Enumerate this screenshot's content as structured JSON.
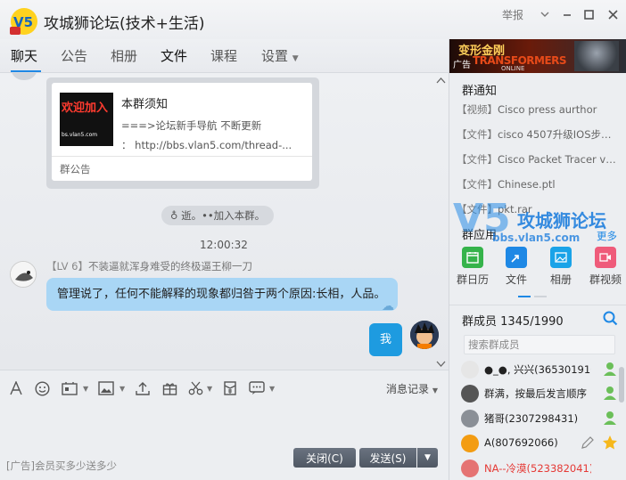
{
  "window": {
    "title": "攻城狮论坛(技术+生活)",
    "report_label": "举报",
    "logo_text": "V5"
  },
  "tabs": [
    {
      "label": "聊天",
      "active": true
    },
    {
      "label": "公告",
      "active": false
    },
    {
      "label": "相册",
      "active": false
    },
    {
      "label": "文件",
      "active": false
    },
    {
      "label": "课程",
      "active": false
    },
    {
      "label": "设置",
      "active": false
    }
  ],
  "notice": {
    "title": "本群须知",
    "line1": "===>论坛新手导航 不断更新",
    "line2": "：   http://bbs.vlan5.com/thread-...",
    "footer": "群公告",
    "thumb_text1": "欢迎加入",
    "thumb_text2": "",
    "thumb_text3": "bs.vlan5.com"
  },
  "chat": {
    "system_message": "♁ 逝。••加入本群。",
    "timestamp": "12:00:32",
    "sender_level": "【LV 6】",
    "sender_name": "不装逼就浑身难受的终极逼王柳一刀",
    "message": "管理说了，任何不能解释的现象都归咎于两个原因:长相，人品。",
    "self_message": "我"
  },
  "toolbar": {
    "history_label": "消息记录"
  },
  "input": {
    "ad_tag": "[广告]",
    "ad_text": "会员买多少送多少",
    "close_label": "关闭(C)",
    "send_label": "发送(S)"
  },
  "right_panel": {
    "banner": {
      "title": "变形金刚",
      "sub": "TRANSFORMERS",
      "online": "ONLINE",
      "ad_tag": "广告"
    },
    "files_title": "群通知",
    "files": [
      {
        "cat": "【视频】",
        "name": "Cisco press aurthor"
      },
      {
        "cat": "【文件】",
        "name": "cisco 4507升级IOS步奏.docx"
      },
      {
        "cat": "【文件】",
        "name": "Cisco Packet Tracer v6.1 fo..."
      },
      {
        "cat": "【文件】",
        "name": "Chinese.ptl"
      },
      {
        "cat": "【文件】",
        "name": "pkt.rar"
      }
    ],
    "watermark": {
      "logo": "V5",
      "name": "攻城狮论坛",
      "url": "bbs.vlan5.com"
    },
    "apps_title": "群应用",
    "apps_more": "更多",
    "apps": [
      {
        "label": "群日历",
        "color": "#35b34a"
      },
      {
        "label": "文件",
        "color": "#1e88e5"
      },
      {
        "label": "相册",
        "color": "#1aa3e8"
      },
      {
        "label": "群视频",
        "color": "#ef5b7a"
      }
    ],
    "members_label": "群成员",
    "members_count": "1345/1990",
    "member_search_placeholder": "搜索群成员",
    "members": [
      {
        "name": "●_●, 兴兴(365301916)",
        "color": "#222222"
      },
      {
        "name": "群满，按最后发言顺序",
        "color": "#222222"
      },
      {
        "name": "猪哥(2307298431)",
        "color": "#222222"
      },
      {
        "name": "A(807692066)",
        "color": "#222222"
      },
      {
        "name": "NA--冷漠(523382041)",
        "color": "#e53935"
      }
    ]
  }
}
